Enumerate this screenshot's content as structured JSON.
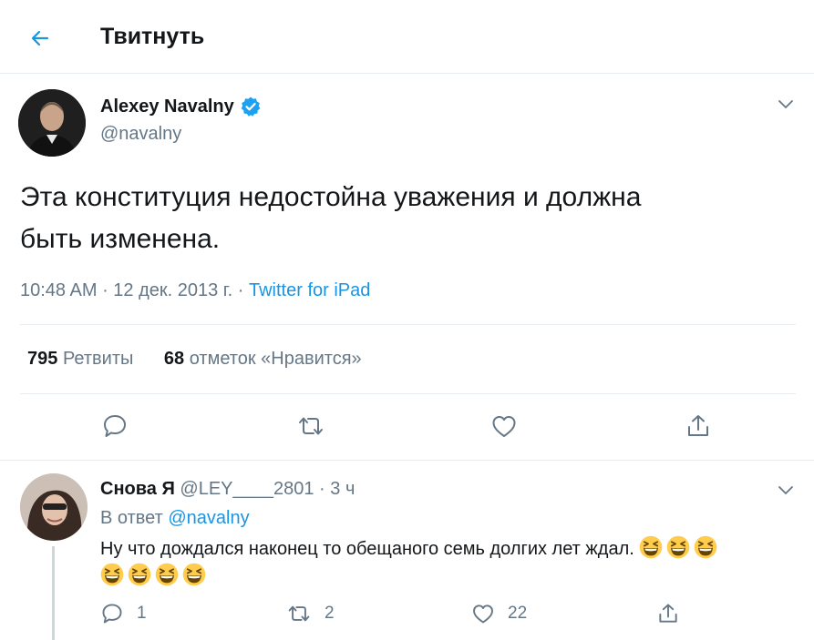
{
  "header": {
    "title": "Твитнуть"
  },
  "tweet": {
    "author_name": "Alexey Navalny",
    "author_handle": "@navalny",
    "text_line1": "Эта конституция недостойна уважения и должна",
    "text_line2": "быть изменена.",
    "time": "10:48 AM",
    "date": "12 дек. 2013 г.",
    "source": "Twitter for iPad",
    "retweets_count": "795",
    "retweets_label": "Ретвиты",
    "likes_count": "68",
    "likes_label": "отметок «Нравится»"
  },
  "reply": {
    "name": "Снова Я",
    "handle": "@LEY____2801",
    "time": "3 ч",
    "reply_to_prefix": "В ответ",
    "reply_to_mention": "@navalny",
    "text": "Ну что дождался наконец то обещаного семь долгих лет ждал.",
    "emoji_line1": [
      "grinning-squinting-face",
      "grinning-squinting-face",
      "grinning-squinting-face"
    ],
    "emoji_line2": [
      "grinning-squinting-face",
      "grinning-squinting-face",
      "grinning-squinting-face",
      "grinning-squinting-face"
    ],
    "reply_count": "1",
    "retweet_count": "2",
    "like_count": "22"
  },
  "colors": {
    "accent": "#1b95e0",
    "muted": "#657786",
    "text": "#14171a",
    "border": "#e6ecf0",
    "verified": "#1da1f2",
    "emoji": "#ffcc4d"
  }
}
